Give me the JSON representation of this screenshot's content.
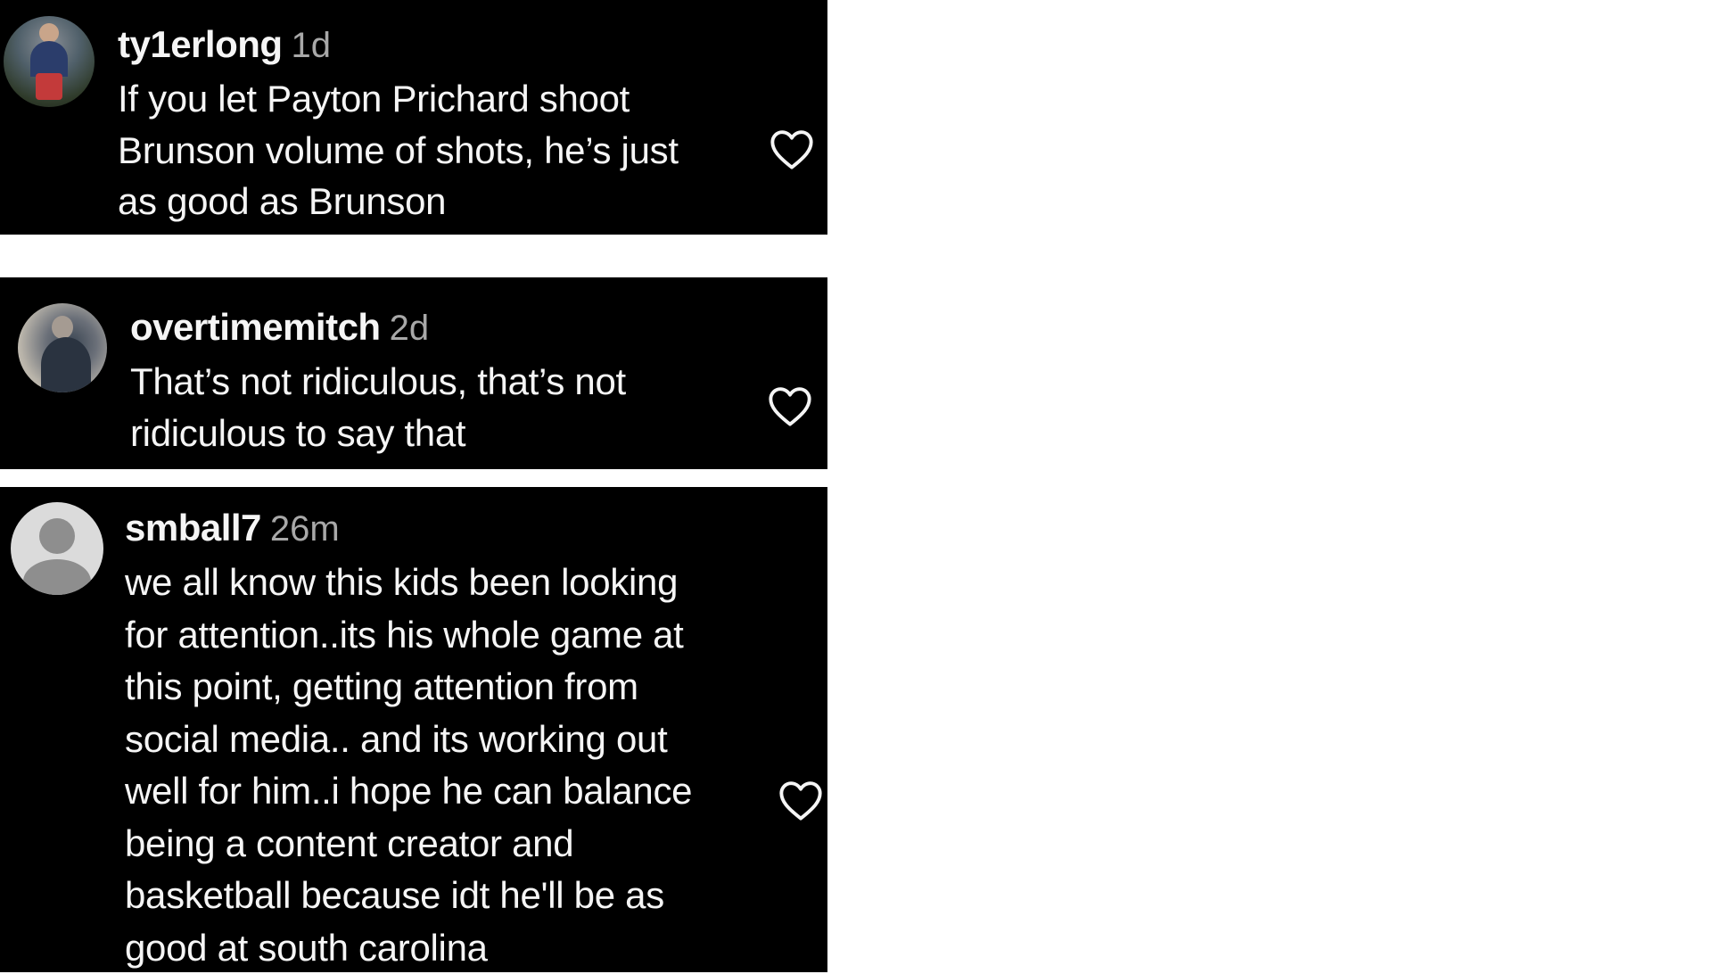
{
  "comments": [
    {
      "username": "ty1erlong",
      "time": "1d",
      "text": "If you let Payton Prichard shoot\nBrunson volume of shots, he’s just\nas good as Brunson",
      "avatar_icon": "user-photo-icon",
      "like_icon": "heart-outline-icon"
    },
    {
      "username": "overtimemitch",
      "time": "2d",
      "text": "That’s not ridiculous, that’s not\nridiculous to say that",
      "avatar_icon": "user-photo-icon",
      "like_icon": "heart-outline-icon"
    },
    {
      "username": "smball7",
      "time": "26m",
      "text": "we all know this kids been looking\nfor attention..its his whole game at\nthis point, getting attention from\nsocial media.. and its working out\nwell for him..i hope he can balance\nbeing a content creator and\nbasketball because idt he'll be as\ngood at south carolina",
      "avatar_icon": "default-avatar-icon",
      "like_icon": "heart-outline-icon"
    }
  ],
  "colors": {
    "card_bg": "#000000",
    "text": "#f5f5f5",
    "timestamp": "#a8a8a8",
    "page_bg": "#ffffff"
  }
}
